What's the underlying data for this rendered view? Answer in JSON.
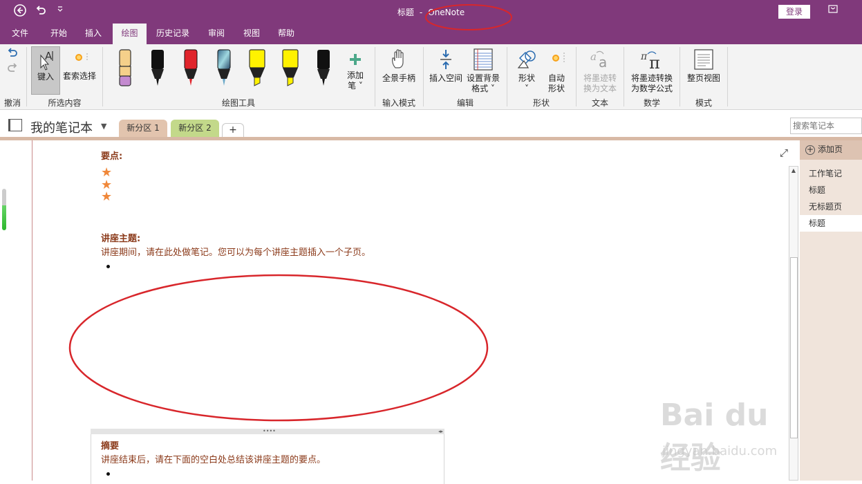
{
  "titlebar": {
    "title_part1": "标题",
    "title_sep": "-",
    "title_part2": "OneNote",
    "login_label": "登录",
    "back_icon": "back-circle-icon",
    "undo_icon": "undo-icon",
    "customize_icon": "customize-toolbar-icon",
    "fullscreen_icon": "fullscreen-icon"
  },
  "menu": {
    "tabs": [
      "文件",
      "开始",
      "插入",
      "绘图",
      "历史记录",
      "审阅",
      "视图",
      "帮助"
    ],
    "active": "绘图"
  },
  "ribbon": {
    "groups": {
      "undo": "撤消",
      "selection": "所选内容",
      "drawing_tools": "绘图工具",
      "input_mode": "输入模式",
      "edit": "编辑",
      "shapes": "形状",
      "text": "文本",
      "math": "数学",
      "mode": "模式"
    },
    "buttons": {
      "type": "键入",
      "lasso": "套索选择",
      "add_pen_line1": "添加",
      "add_pen_line2": "笔 ˅",
      "pan": "全景手柄",
      "insert_space": "插入空间",
      "set_background_line1": "设置背景",
      "set_background_line2": "格式 ˅",
      "shapes_line1": "形状",
      "shapes_line2": "˅",
      "auto_shapes_line1": "自动",
      "auto_shapes_line2": "形状",
      "ink_to_text_line1": "将墨迹转",
      "ink_to_text_line2": "换为文本",
      "ink_to_math_line1": "将墨迹转换",
      "ink_to_math_line2": "为数学公式",
      "full_page_view": "整页视图"
    },
    "pen_colors": [
      "#F5D08A",
      "#111111",
      "#E0242B",
      "#5FA0C8",
      "#FFF200",
      "#FFF200",
      "#111111"
    ]
  },
  "notebook": {
    "name": "我的笔记本",
    "sections": [
      {
        "label": "新分区 1",
        "color": "#E2C4AE"
      },
      {
        "label": "新分区 2",
        "color": "#C3D98A"
      }
    ],
    "add_section": "+",
    "search_placeholder": "搜索笔记本"
  },
  "page": {
    "key_points_heading": "要点:",
    "topic_heading": "讲座主题:",
    "topic_text": "讲座期间，请在此处做笔记。您可以为每个讲座主题插入一个子页。",
    "summary_heading": "摘要",
    "summary_text": "讲座结束后，请在下面的空白处总结该讲座主题的要点。",
    "star_glyph": "★"
  },
  "pages": {
    "add_page": "添加页",
    "items": [
      "工作笔记",
      "标题",
      "无标题页",
      "标题"
    ],
    "selected_index": 3
  },
  "watermark": {
    "brand": "Bai du 经验",
    "url": "jingyan.baidu.com"
  },
  "colors": {
    "accent": "#80397B",
    "note_text": "#8B3A1A",
    "annotation": "#D8262B"
  }
}
